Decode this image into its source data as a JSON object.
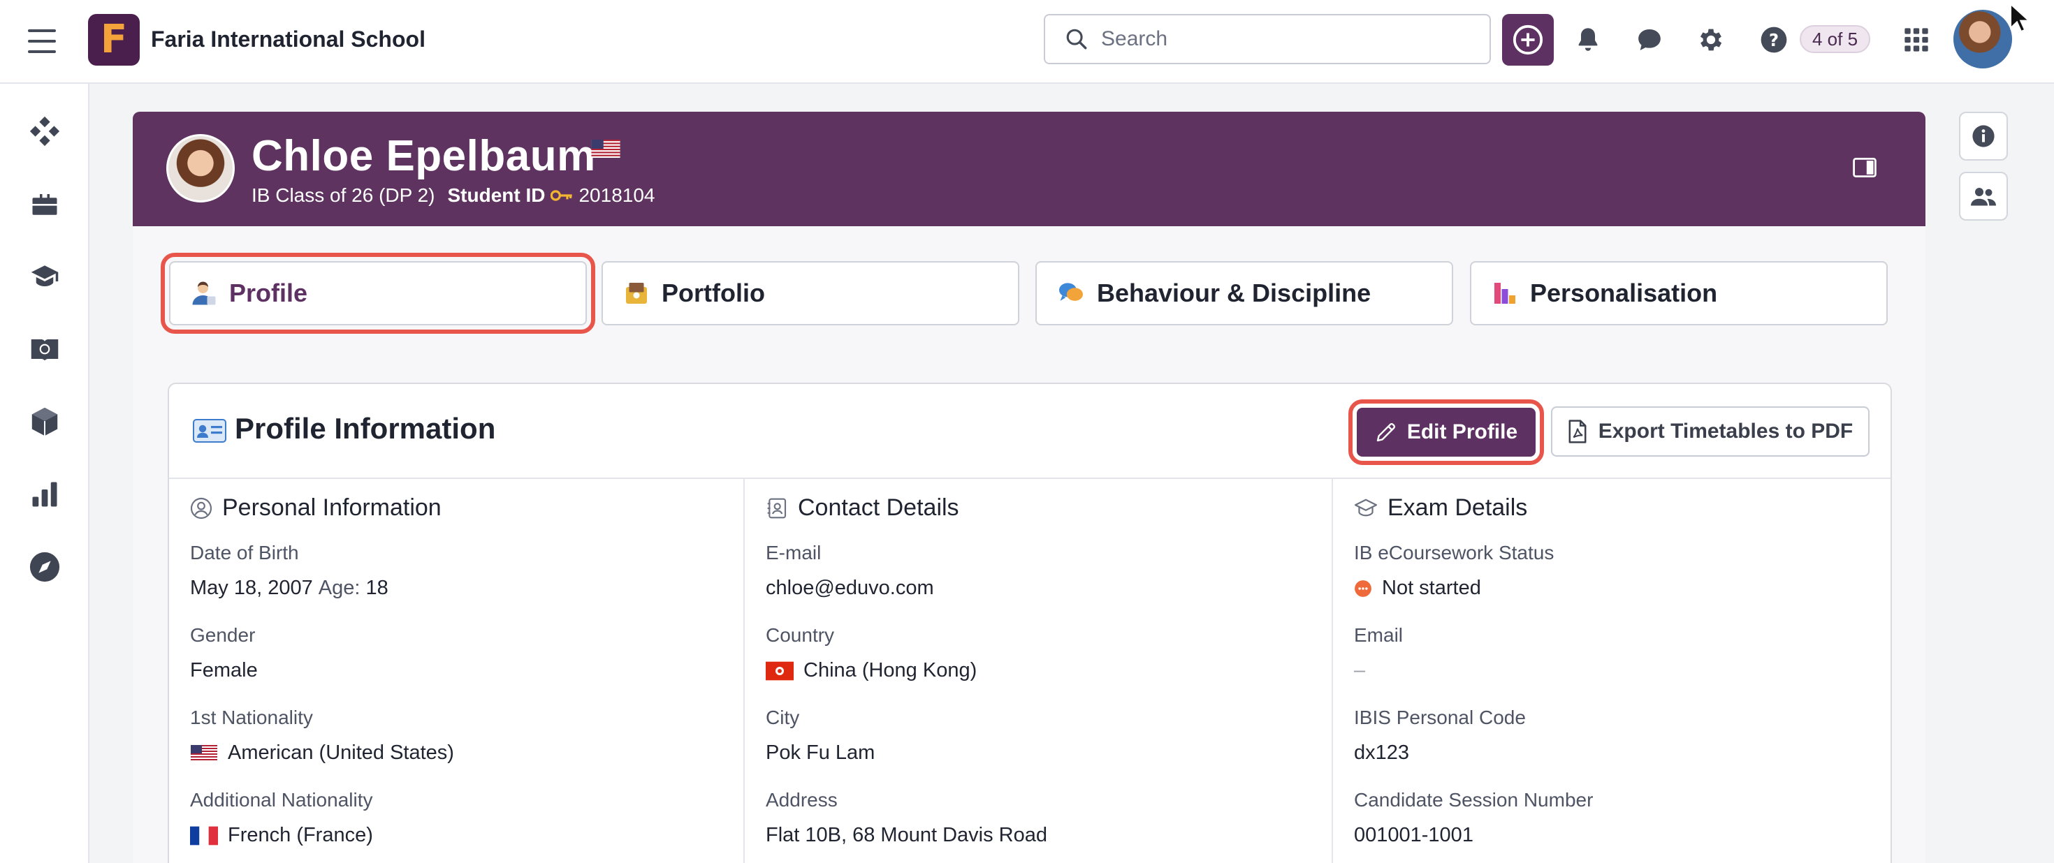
{
  "topbar": {
    "school_name": "Faria International School",
    "logo_letter": "F",
    "search_placeholder": "Search",
    "pager": "4 of 5",
    "brand_color": "#5e3163"
  },
  "student": {
    "name": "Chloe Epelbaum",
    "class": "IB Class of 26 (DP 2)",
    "student_id_label": "Student ID",
    "student_id": "2018104"
  },
  "tabs": [
    {
      "label": "Profile",
      "active": true
    },
    {
      "label": "Portfolio",
      "active": false
    },
    {
      "label": "Behaviour & Discipline",
      "active": false
    },
    {
      "label": "Personalisation",
      "active": false
    }
  ],
  "card": {
    "title": "Profile Information",
    "edit_label": "Edit Profile",
    "export_label": "Export Timetables to PDF"
  },
  "personal": {
    "heading": "Personal Information",
    "dob_label": "Date of Birth",
    "dob": "May 18, 2007",
    "age_label": "Age:",
    "age": "18",
    "gender_label": "Gender",
    "gender": "Female",
    "nat1_label": "1st Nationality",
    "nat1": "American (United States)",
    "nat2_label": "Additional Nationality",
    "nat2": "French (France)"
  },
  "contact": {
    "heading": "Contact Details",
    "email_label": "E-mail",
    "email": "chloe@eduvo.com",
    "country_label": "Country",
    "country": "China (Hong Kong)",
    "city_label": "City",
    "city": "Pok Fu Lam",
    "address_label": "Address",
    "address": "Flat 10B, 68 Mount Davis Road"
  },
  "exam": {
    "heading": "Exam Details",
    "ecw_label": "IB eCoursework Status",
    "ecw": "Not started",
    "email_label": "Email",
    "email": "–",
    "ibis_label": "IBIS Personal Code",
    "ibis": "dx123",
    "session_label": "Candidate Session Number",
    "session": "001001-1001"
  }
}
